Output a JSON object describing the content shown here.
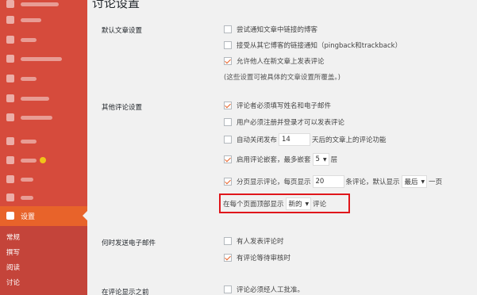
{
  "page_title": "讨论设置",
  "sidebar": {
    "active_label": "设置",
    "sub_items": [
      "常规",
      "撰写",
      "阅读",
      "讨论"
    ]
  },
  "sections": {
    "default_article": {
      "label": "默认文章设置",
      "options": [
        {
          "label": "尝试通知文章中链接的博客",
          "checked": false
        },
        {
          "label": "接受从其它博客的链接通知（pingback和trackback）",
          "checked": false
        },
        {
          "label": "允许他人在新文章上发表评论",
          "checked": true
        }
      ],
      "note": "(这些设置可被具体的文章设置所覆盖。)"
    },
    "other_comment": {
      "label": "其他评论设置",
      "require_name_email": {
        "label": "评论者必须填写姓名和电子邮件",
        "checked": true
      },
      "require_registration": {
        "label": "用户必须注册并登录才可以发表评论",
        "checked": false
      },
      "auto_close": {
        "pre": "自动关闭发布",
        "value": "14",
        "post": "天后的文章上的评论功能",
        "checked": false
      },
      "threaded": {
        "pre": "启用评论嵌套，最多嵌套",
        "value": "5",
        "post": "层",
        "checked": true
      },
      "paginate": {
        "pre": "分页显示评论，每页显示",
        "value": "20",
        "mid": "条评论，默认显示",
        "select": "最后",
        "post": "一页",
        "checked": true
      },
      "order": {
        "pre": "在每个页面顶部显示",
        "select": "新的",
        "post": "评论"
      }
    },
    "email": {
      "label": "何时发送电子邮件",
      "options": [
        {
          "label": "有人发表评论时",
          "checked": false
        },
        {
          "label": "有评论等待审核时",
          "checked": true
        }
      ]
    },
    "before_comment": {
      "label": "在评论显示之前",
      "options": [
        {
          "label": "评论必须经人工批准。",
          "checked": false
        }
      ]
    }
  }
}
